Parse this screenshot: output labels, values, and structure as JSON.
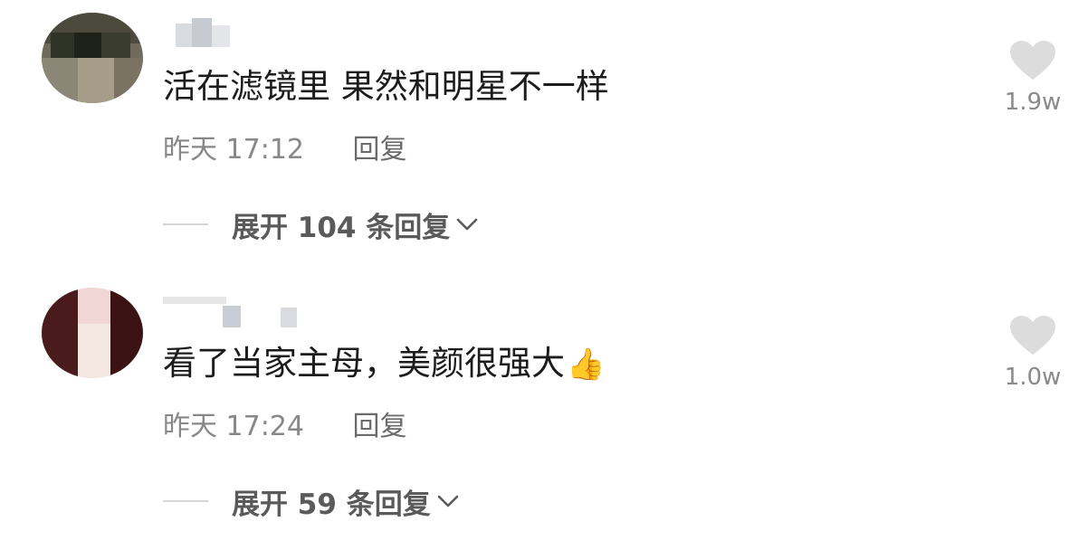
{
  "comments": [
    {
      "text": "活在滤镜里 果然和明星不一样",
      "time": "昨天 17:12",
      "reply_label": "回复",
      "expand_label": "展开 104 条回复",
      "like_count": "1.9w",
      "like_icon": "heart-icon",
      "expand_icon": "chevron-down-icon"
    },
    {
      "text": "看了当家主母，美颜很强大",
      "emoji": "👍",
      "time": "昨天 17:24",
      "reply_label": "回复",
      "expand_label": "展开 59 条回复",
      "like_count": "1.0w",
      "like_icon": "heart-icon",
      "expand_icon": "chevron-down-icon"
    }
  ]
}
